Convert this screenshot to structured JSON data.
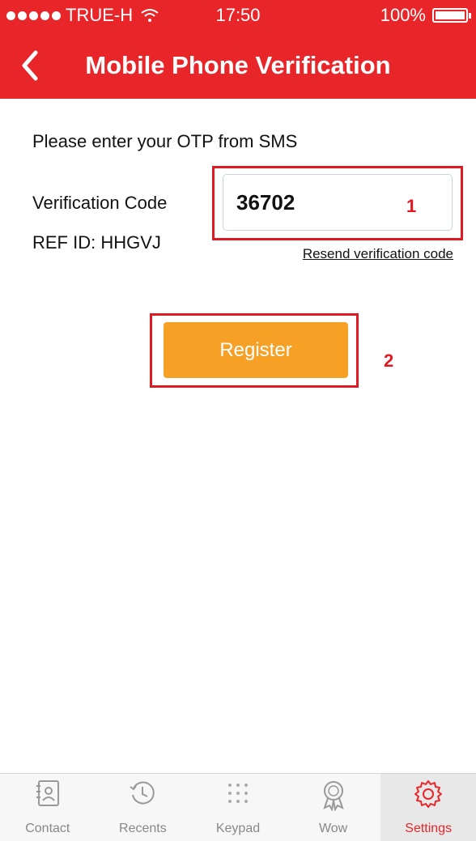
{
  "status_bar": {
    "carrier": "TRUE-H",
    "time": "17:50",
    "battery": "100%"
  },
  "nav": {
    "title": "Mobile Phone Verification",
    "back_icon": "chevron-left-icon"
  },
  "form": {
    "prompt": "Please enter your OTP from SMS",
    "code_label": "Verification Code",
    "code_value": "36702",
    "ref_id": "REF ID: HHGVJ",
    "resend_link": "Resend verification code",
    "register_label": "Register"
  },
  "annotations": {
    "step1": "1",
    "step2": "2",
    "color": "#e01a22"
  },
  "tab_bar": {
    "items": [
      {
        "label": "Contact",
        "icon": "contact-card-icon",
        "active": false
      },
      {
        "label": "Recents",
        "icon": "clock-history-icon",
        "active": false
      },
      {
        "label": "Keypad",
        "icon": "keypad-dots-icon",
        "active": false
      },
      {
        "label": "Wow",
        "icon": "wow-badge-icon",
        "active": false
      },
      {
        "label": "Settings",
        "icon": "gear-icon",
        "active": true
      }
    ]
  },
  "colors": {
    "brand_red": "#e8262a",
    "register_orange": "#f6a126",
    "tab_inactive": "#888888"
  }
}
